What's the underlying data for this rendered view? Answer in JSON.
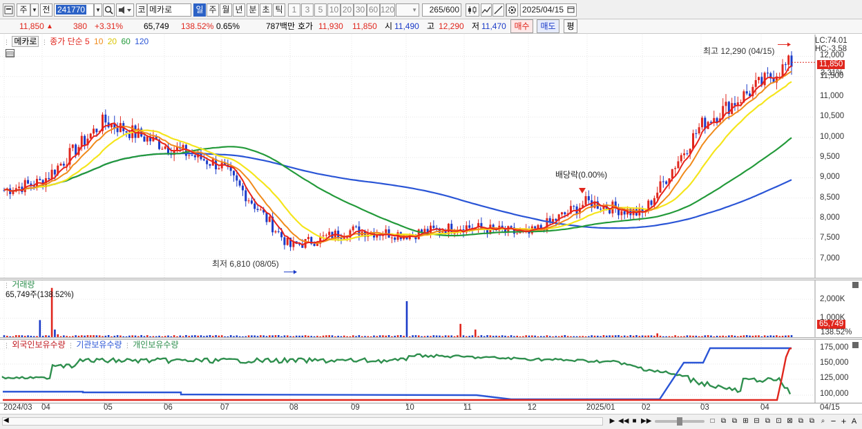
{
  "toolbar": {
    "market_label": "주",
    "prev_label": "전",
    "stock_code": "241770",
    "market_type_label": "코",
    "stock_name": "메카로",
    "period_buttons": [
      "일",
      "주",
      "월",
      "년",
      "분",
      "초",
      "틱"
    ],
    "minute_buttons": [
      "1",
      "3",
      "5",
      "10",
      "20",
      "30",
      "60",
      "120"
    ],
    "count_current": "265",
    "count_total": "/600",
    "date": "2025/04/15"
  },
  "quote": {
    "price": "11,850",
    "change": "380",
    "change_pct": "+3.31%",
    "volume": "65,749",
    "volume_ratio": "138.52%",
    "turnover": "0.65%",
    "amount": "787백만",
    "ask_label": "호가",
    "ask_price": "11,930",
    "bid_price": "11,850",
    "open_label": "시",
    "open": "11,490",
    "high_label": "고",
    "high": "12,290",
    "low_label": "저",
    "low": "11,470",
    "buy_label": "매수",
    "sell_label": "매도",
    "eval_label": "평"
  },
  "price_pane": {
    "name_label": "메카로",
    "ma_label": "종가 단순",
    "ma_periods": [
      "5",
      "10",
      "20",
      "60",
      "120"
    ],
    "lc_label": "LC:74.01",
    "hc_label": "HC:-3.58",
    "current_price_tag": "11,850",
    "current_pct_tag": "3.31%",
    "high_annotation": "최고 12,290 (04/15)",
    "low_annotation": "최저 6,810 (08/05)",
    "dividend_annotation": "배당락(0.00%)",
    "y_ticks": [
      "12,000",
      "11,500",
      "11,000",
      "10,500",
      "10,000",
      "9,500",
      "9,000",
      "8,500",
      "8,000",
      "7,500",
      "7,000"
    ]
  },
  "volume_pane": {
    "title": "거래량",
    "value_label": "65,749주(138.52%)",
    "y_ticks": [
      "2,000K",
      "1,000K"
    ],
    "current_tag": "65,749",
    "pct_tag": "138.52%"
  },
  "holding_pane": {
    "legend": [
      "외국인보유수량",
      "기관보유수량",
      "개인보유수량"
    ],
    "y_ticks": [
      "175,000",
      "150,000",
      "125,000",
      "100,000"
    ]
  },
  "x_axis": {
    "labels": [
      "2024/03",
      "04",
      "05",
      "06",
      "07",
      "08",
      "09",
      "10",
      "11",
      "12",
      "2025/01",
      "02",
      "03",
      "04"
    ],
    "right_label": "04/15"
  },
  "colors": {
    "up": "#e0261d",
    "down": "#1b3bc8",
    "ma5": "#e8231a",
    "ma10": "#f08a1a",
    "ma20": "#f5e51c",
    "ma60": "#239a3a",
    "ma120": "#2a55d6",
    "foreign": "#e0261d",
    "institution": "#2a55d6",
    "individual": "#2f8f4e"
  },
  "chart_data": {
    "type": "candlestick",
    "x_range": [
      "2024/03",
      "2025/04/15"
    ],
    "price_ylim": [
      6600,
      12400
    ],
    "approx_close_path": [
      {
        "x": "2024/03",
        "close": 8700
      },
      {
        "x": "2024/04",
        "close": 8900
      },
      {
        "x": "2024/05",
        "close": 10400
      },
      {
        "x": "2024/06",
        "close": 9800
      },
      {
        "x": "2024/07",
        "close": 9300
      },
      {
        "x": "2024/08",
        "close": 7300
      },
      {
        "x": "2024/09",
        "close": 7700
      },
      {
        "x": "2024/10",
        "close": 7600
      },
      {
        "x": "2024/11",
        "close": 7800
      },
      {
        "x": "2024/12",
        "close": 7600
      },
      {
        "x": "2025/01",
        "close": 8400
      },
      {
        "x": "2025/02",
        "close": 8100
      },
      {
        "x": "2025/03",
        "close": 10300
      },
      {
        "x": "2025/04/15",
        "close": 11850
      }
    ],
    "high": {
      "value": 12290,
      "date": "04/15"
    },
    "low": {
      "value": 6810,
      "date": "08/05"
    },
    "volume_ylim": [
      0,
      2700
    ]
  }
}
